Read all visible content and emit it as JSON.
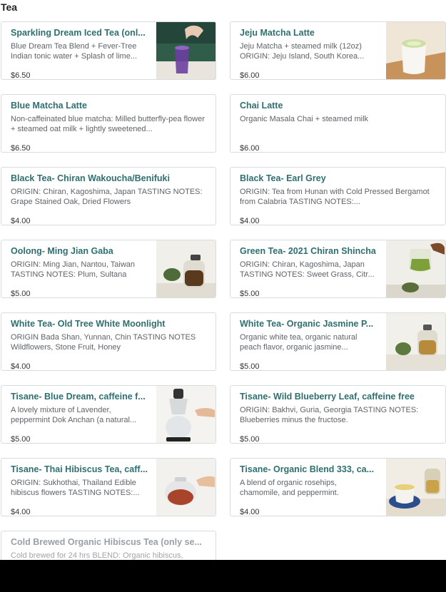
{
  "section": {
    "title": "Tea"
  },
  "items": [
    {
      "name": "Sparkling Dream Iced Tea (onl...",
      "desc": "Blue Dream Tea Blend + Fever-Tree Indian tonic water + Splash of lime...",
      "price": "$6.50",
      "image": "iced-tea-photo"
    },
    {
      "name": "Jeju Matcha Latte",
      "desc": "Jeju Matcha + steamed milk (12oz) ORIGIN: Jeju Island, South Korea...",
      "price": "$6.00",
      "image": "matcha-latte-photo"
    },
    {
      "name": "Blue Matcha Latte",
      "desc": "Non-caffeinated blue matcha: Milled butterfly-pea flower + steamed oat milk + lightly sweetened...",
      "price": "$6.50",
      "image": null
    },
    {
      "name": "Chai Latte",
      "desc": "Organic Masala Chai + steamed milk",
      "price": "$6.00",
      "image": null
    },
    {
      "name": "Black Tea- Chiran Wakoucha/Benifuki",
      "desc": "ORIGIN: Chiran, Kagoshima, Japan TASTING NOTES: Grape Stained Oak, Dried Flowers",
      "price": "$4.00",
      "image": null
    },
    {
      "name": "Black Tea- Earl Grey",
      "desc": "ORIGIN: Tea from Hunan with Cold Pressed Bergamot from Calabria TASTING NOTES:...",
      "price": "$4.00",
      "image": null
    },
    {
      "name": "Oolong- Ming Jian Gaba",
      "desc": "ORIGIN: Ming Jian, Nantou, Taiwan TASTING NOTES: Plum, Sultana",
      "price": "$5.00",
      "image": "oolong-teapot-photo"
    },
    {
      "name": "Green Tea- 2021 Chiran Shincha",
      "desc": "ORIGIN: Chiran, Kagoshima, Japan TASTING NOTES: Sweet Grass, Citr...",
      "price": "$5.00",
      "image": "green-tea-pour-photo"
    },
    {
      "name": "White Tea- Old Tree White Moonlight",
      "desc": "ORIGIN Bada Shan, Yunnan, Chin TASTING NOTES Wildflowers, Stone Fruit, Honey",
      "price": "$4.00",
      "image": null
    },
    {
      "name": "White Tea- Organic Jasmine P...",
      "desc": "Organic white tea, organic natural peach flavor, organic jasmine...",
      "price": "$5.00",
      "image": "jasmine-teapot-photo"
    },
    {
      "name": "Tisane- Blue Dream, caffeine f...",
      "desc": "A lovely mixture of Lavender, peppermint Dok Anchan (a natural...",
      "price": "$5.00",
      "image": "siphon-brewer-photo"
    },
    {
      "name": "Tisane- Wild Blueberry Leaf, caffeine free",
      "desc": "ORIGIN: Bakhvi, Guria, Georgia TASTING NOTES: Blueberries minus the fructose.",
      "price": "$5.00",
      "image": null
    },
    {
      "name": "Tisane- Thai Hibiscus Tea, caff...",
      "desc": "ORIGIN: Sukhothai, Thailand Edible hibiscus flowers TASTING NOTES:...",
      "price": "$4.00",
      "image": "hibiscus-teapot-photo"
    },
    {
      "name": "Tisane- Organic Blend 333, ca...",
      "desc": "A blend of organic rosehips, chamomile, and peppermint.",
      "price": "$4.00",
      "image": "blend-cup-photo"
    },
    {
      "name": "Cold Brewed Organic Hibiscus Tea (only se...",
      "desc": "Cold brewed for 24 hrs BLEND: Organic hibiscus,",
      "price": "",
      "image": null
    }
  ]
}
